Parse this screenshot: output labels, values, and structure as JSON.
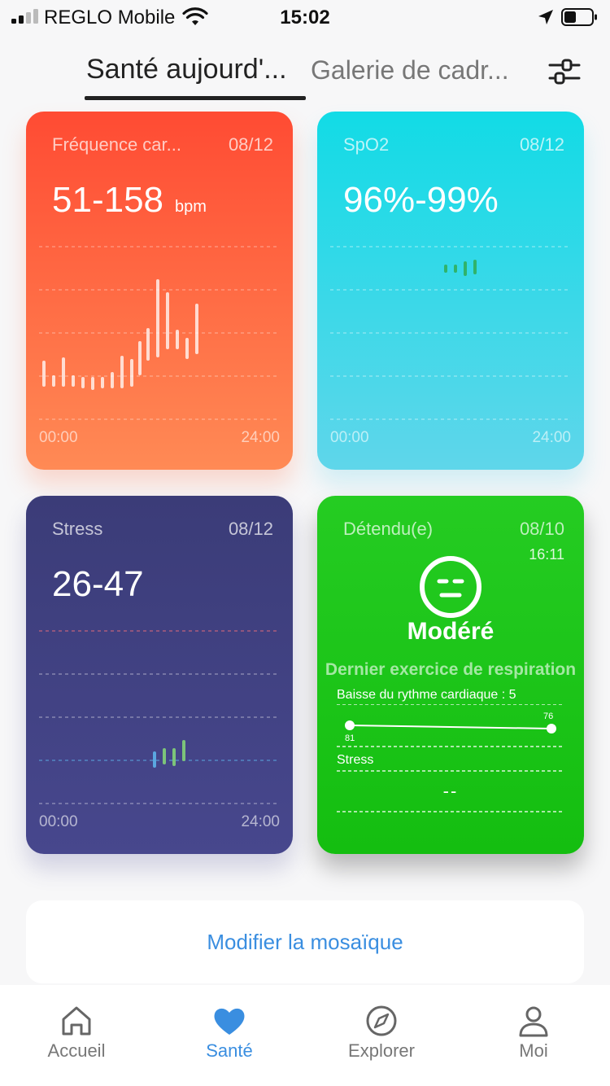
{
  "status_bar": {
    "carrier": "REGLO Mobile",
    "time": "15:02"
  },
  "tabs": {
    "active": "Santé aujourd'...",
    "inactive": "Galerie de cadr..."
  },
  "cards": {
    "heart_rate": {
      "title": "Fréquence car...",
      "date": "08/12",
      "value": "51-158",
      "unit": "bpm",
      "time_start": "00:00",
      "time_end": "24:00",
      "color_top": "#ff4b33",
      "color_bottom": "#ff8a55"
    },
    "spo2": {
      "title": "SpO2",
      "date": "08/12",
      "value": "96%-99%",
      "time_start": "00:00",
      "time_end": "24:00",
      "color_top": "#12dbe6",
      "color_bottom": "#5fd6ea"
    },
    "stress": {
      "title": "Stress",
      "date": "08/12",
      "value": "26-47",
      "time_start": "00:00",
      "time_end": "24:00",
      "color_top": "#3b3c78",
      "color_bottom": "#47478d"
    },
    "relax": {
      "title": "Détendu(e)",
      "date": "08/10",
      "time": "16:11",
      "mood": "Modéré",
      "breathing_title": "Dernier exercice de respiration",
      "hr_drop_label": "Baisse du rythme cardiaque : 5",
      "hr_start": "81",
      "hr_end": "76",
      "stress_label": "Stress",
      "stress_value": "--",
      "color": "#1ec41a"
    }
  },
  "edit_tile": {
    "label": "Modifier la mosaïque"
  },
  "bottom_nav": {
    "items": [
      {
        "label": "Accueil",
        "icon": "home-icon"
      },
      {
        "label": "Santé",
        "icon": "heart-icon"
      },
      {
        "label": "Explorer",
        "icon": "compass-icon"
      },
      {
        "label": "Moi",
        "icon": "person-icon"
      }
    ],
    "active_color": "#3a8ee0"
  }
}
